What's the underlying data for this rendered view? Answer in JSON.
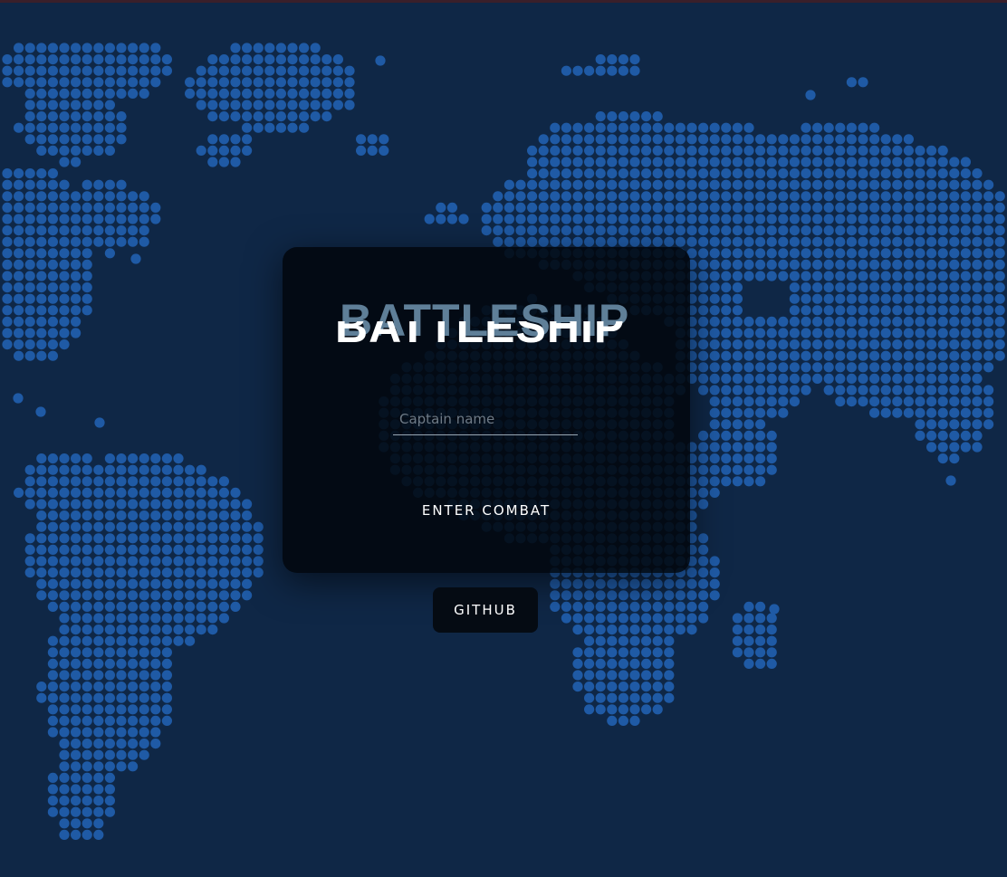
{
  "theme": {
    "background": "#0f2746",
    "dot_color": "#1f5aa5",
    "card_background": "#01060c",
    "title_shadow_color": "#5f7f98",
    "text_color": "#ffffff"
  },
  "background": {
    "icon": "world-map-dots"
  },
  "login": {
    "title": "BATTLESHIP",
    "name_placeholder": "Captain name",
    "name_value": "",
    "enter_label": "ENTER COMBAT"
  },
  "links": {
    "github_label": "GITHUB"
  }
}
